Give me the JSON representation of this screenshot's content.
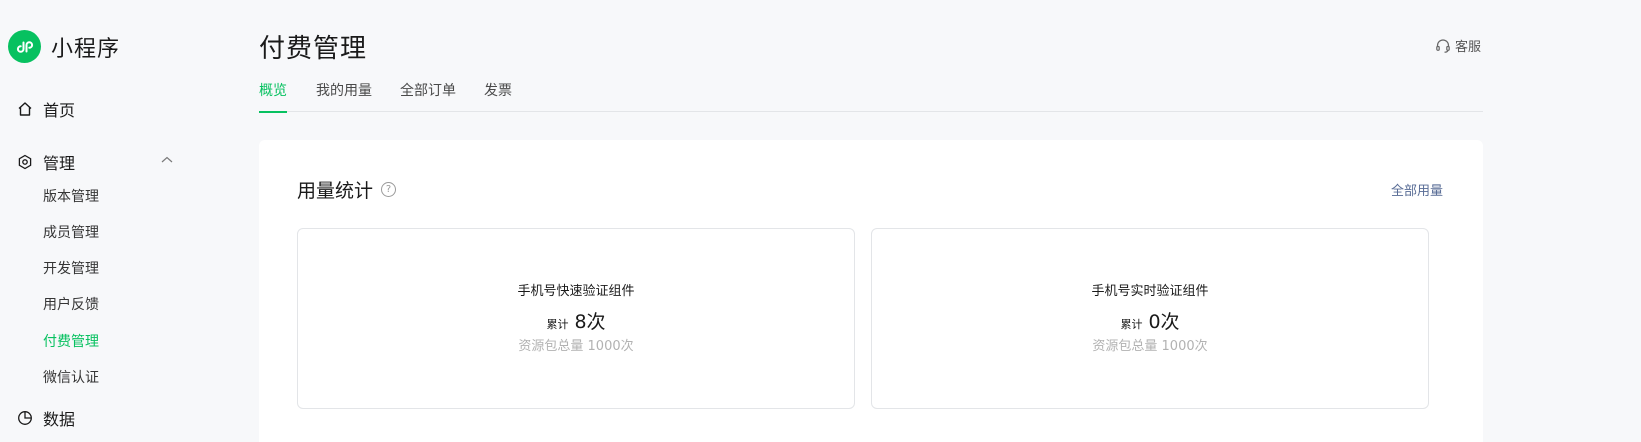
{
  "brand": {
    "name": "小程序"
  },
  "sidebar": {
    "home": "首页",
    "manage": "管理",
    "sub_items": [
      {
        "label": "版本管理",
        "active": false
      },
      {
        "label": "成员管理",
        "active": false
      },
      {
        "label": "开发管理",
        "active": false
      },
      {
        "label": "用户反馈",
        "active": false
      },
      {
        "label": "付费管理",
        "active": true
      },
      {
        "label": "微信认证",
        "active": false
      }
    ],
    "data": "数据"
  },
  "header": {
    "title": "付费管理",
    "service": "客服"
  },
  "tabs": [
    {
      "label": "概览",
      "active": true
    },
    {
      "label": "我的用量",
      "active": false
    },
    {
      "label": "全部订单",
      "active": false
    },
    {
      "label": "发票",
      "active": false
    }
  ],
  "panel": {
    "title": "用量统计",
    "help": "?",
    "link": "全部用量",
    "cards": [
      {
        "name": "手机号快速验证组件",
        "count_label": "累计",
        "count": "8次",
        "quota": "资源包总量 1000次"
      },
      {
        "name": "手机号实时验证组件",
        "count_label": "累计",
        "count": "0次",
        "quota": "资源包总量 1000次"
      }
    ]
  },
  "colors": {
    "accent": "#07c160",
    "link": "#576b95",
    "muted": "#b2b2b2"
  },
  "icons": [
    "miniprogram-logo-icon",
    "home-icon",
    "manage-icon",
    "chevron-up-icon",
    "data-icon",
    "headset-icon",
    "help-icon"
  ]
}
